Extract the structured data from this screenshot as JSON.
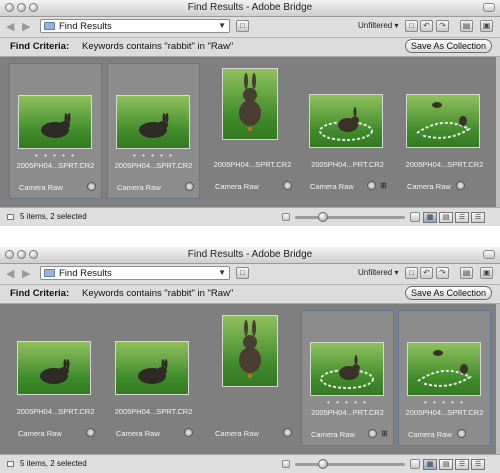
{
  "window_title": "Find Results - Adobe Bridge",
  "toolbar": {
    "path_label": "Find Results",
    "filter_label": "Unfiltered ▾",
    "icons": [
      "back-arrow-icon",
      "forward-arrow-icon",
      "folder-icon",
      "recent-folder-icon",
      "new-folder-icon",
      "rotate-left-icon",
      "rotate-right-icon",
      "trash-icon",
      "compact-mode-icon"
    ]
  },
  "criteria": {
    "label": "Find Criteria:",
    "text": "Keywords contains \"rabbit\" in \"Raw\"",
    "save_button": "Save As Collection"
  },
  "files": [
    {
      "name": "2005PH04...SPRT.CR2",
      "meta": "Camera Raw",
      "dots": "• • • • •"
    },
    {
      "name": "2005PH04...SPRT.CR2",
      "meta": "Camera Raw",
      "dots": "• • • • •"
    },
    {
      "name": "2005PH04...SPRT.CR2",
      "meta": "Camera Raw",
      "dots": ""
    },
    {
      "name": "2005PH04...PRT.CR2",
      "meta": "Camera Raw",
      "dots": ""
    },
    {
      "name": "2005PH04...SPRT.CR2",
      "meta": "Camera Raw",
      "dots": ""
    }
  ],
  "files_bottom": [
    {
      "name": "2005PH04...SPRT.CR2",
      "meta": "Camera Raw",
      "dots": ""
    },
    {
      "name": "2005PH04...SPRT.CR2",
      "meta": "Camera Raw",
      "dots": ""
    },
    {
      "name": "",
      "meta": "Camera Raw",
      "dots": ""
    },
    {
      "name": "2005PH04...PRT.CR2",
      "meta": "Camera Raw",
      "dots": "• • • • •"
    },
    {
      "name": "2005PH04...SPRT.CR2",
      "meta": "Camera Raw",
      "dots": "• • • • •"
    }
  ],
  "status": {
    "text": "5 items, 2 selected"
  },
  "windows": [
    {
      "selected": [
        0,
        1
      ]
    },
    {
      "selected": [
        3,
        4
      ]
    }
  ],
  "colors": {
    "content_bg": "#7f7f7f",
    "selection_border": "#5b78a3",
    "chrome": "#e6e6e6"
  }
}
